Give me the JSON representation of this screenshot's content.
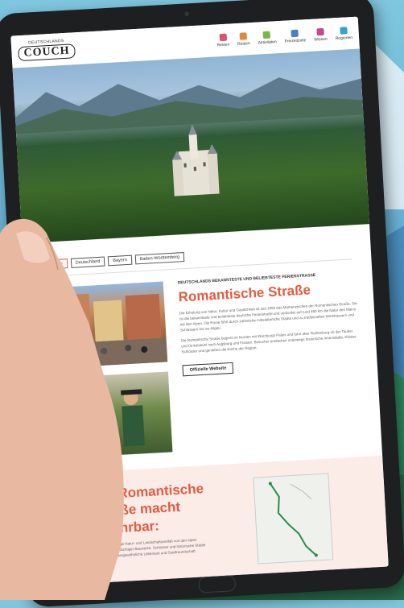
{
  "site": {
    "logo_small": "DEUTSCHLANDS",
    "logo_big": "COUCH"
  },
  "nav": [
    {
      "label": "Reisen",
      "color": "#d9536f",
      "icon": "suitcase-icon"
    },
    {
      "label": "Reisen",
      "color": "#e08a3a",
      "icon": "map-icon"
    },
    {
      "label": "Aktivitäten",
      "color": "#7ab648",
      "icon": "hiking-icon"
    },
    {
      "label": "Freizeitziele",
      "color": "#4a7fc4",
      "icon": "car-icon"
    },
    {
      "label": "Wissen",
      "color": "#c44a8a",
      "icon": "book-icon"
    },
    {
      "label": "Regionen",
      "color": "#3a9ed0",
      "icon": "globe-icon"
    }
  ],
  "breadcrumbs": [
    "Home",
    "Deutschland",
    "Bayern",
    "Baden-Württemberg"
  ],
  "article": {
    "kicker": "DEUTSCHLANDS BEKANNTESTE UND BELIEBTESTE FERIENSTRASSE",
    "title": "Romantische Straße",
    "para1": "Die Erholung von Natur, Kultur und Gastlichkeit ist seit 1950 das Markenzeichen der Romantischen Straße. Sie ist die bekannteste und beliebteste deutsche Ferienstraße und verbindet auf rund 460 km die Natur des Mains mit den Alpen. Die Route führt durch zahlreiche mittelalterliche Städte und zu traditionellen Wirtshäusern und Schlössern bis ins Allgäu.",
    "para2": "Die Romantische Straße beginnt im Norden mit Würzburgs Palais und führt über Rothenburg ob der Tauber und Dinkelsbühl nach Augsburg und Füssen. Besucher entdecken unterwegs historische Innenstädte, Klöster, Schlösser und genießen die Küche der Region.",
    "button": "Offizielle Website"
  },
  "teaser": {
    "title": "Die Romantische Straße macht erfahrbar:",
    "bullets": [
      "... die einzigartige Natur- und Landschaftsvielfalt von den Alpen",
      "... Zeugnisse prächtiger Bauwerke, Schlösser und historische Städte",
      "... und die außergewöhnliche Lebensart und Gastfreundschaft"
    ]
  }
}
